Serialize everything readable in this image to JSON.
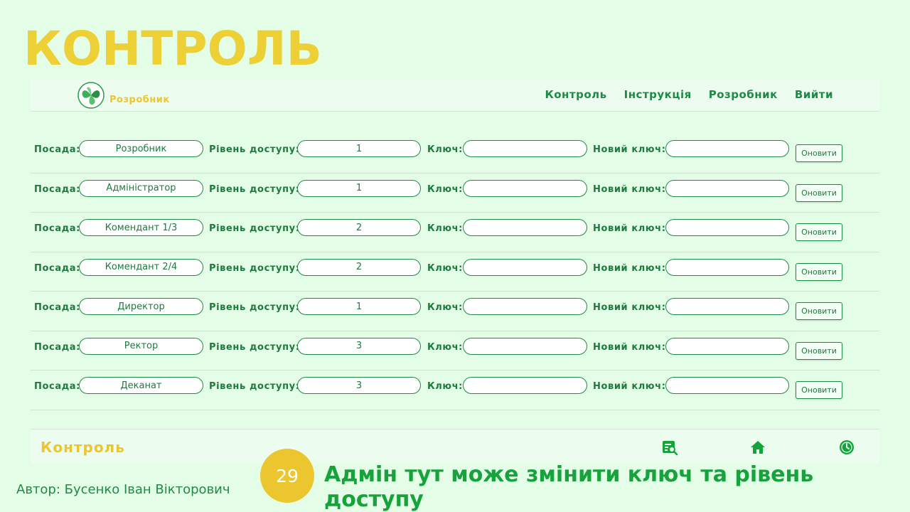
{
  "slide": {
    "title": "КОНТРОЛЬ",
    "author": "Автор: Бусенко Іван Вікторович",
    "page_number": "29",
    "caption": "Адмін тут може змінити ключ та рівень доступу"
  },
  "navbar": {
    "brand": "Розробник",
    "links": [
      "Контроль",
      "Інструкція",
      "Розробник",
      "Вийти"
    ]
  },
  "labels": {
    "position": "Посада:",
    "access_level": "Рівень доступу:",
    "key": "Ключ:",
    "new_key": "Новий ключ:",
    "update_button": "Оновити"
  },
  "rows": [
    {
      "position": "Розробник",
      "access_level": "1",
      "key": "",
      "new_key": ""
    },
    {
      "position": "Адміністратор",
      "access_level": "1",
      "key": "",
      "new_key": ""
    },
    {
      "position": "Комендант 1/3",
      "access_level": "2",
      "key": "",
      "new_key": ""
    },
    {
      "position": "Комендант 2/4",
      "access_level": "2",
      "key": "",
      "new_key": ""
    },
    {
      "position": "Директор",
      "access_level": "1",
      "key": "",
      "new_key": ""
    },
    {
      "position": "Ректор",
      "access_level": "3",
      "key": "",
      "new_key": ""
    },
    {
      "position": "Деканат",
      "access_level": "3",
      "key": "",
      "new_key": ""
    }
  ],
  "footer": {
    "title": "Контроль",
    "icons": [
      "search-list-icon",
      "home-icon",
      "clock-icon"
    ]
  },
  "colors": {
    "background": "#e3fde7",
    "accent_yellow": "#ecc62f",
    "accent_green": "#1f8a45",
    "caption_green": "#17a33c"
  }
}
